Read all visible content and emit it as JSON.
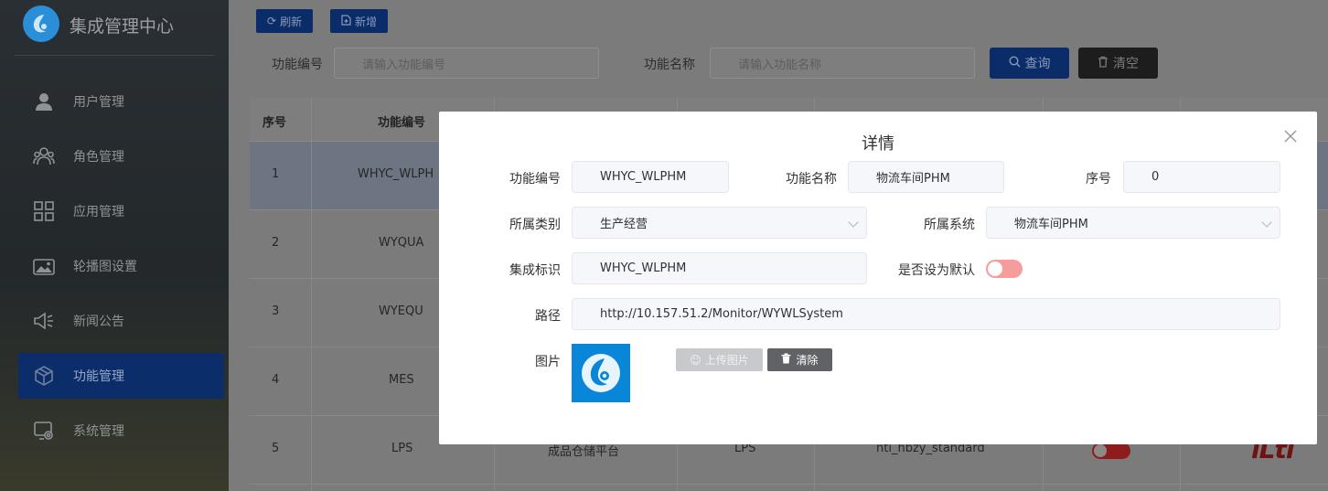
{
  "brand": {
    "title": "集成管理中心"
  },
  "sidebar": {
    "items": [
      {
        "label": "用户管理",
        "icon": "user-icon"
      },
      {
        "label": "角色管理",
        "icon": "role-icon"
      },
      {
        "label": "应用管理",
        "icon": "apps-grid-icon"
      },
      {
        "label": "轮播图设置",
        "icon": "image-icon"
      },
      {
        "label": "新闻公告",
        "icon": "megaphone-icon"
      },
      {
        "label": "功能管理",
        "icon": "box-icon",
        "active": true
      },
      {
        "label": "系统管理",
        "icon": "settings-screen-icon"
      }
    ]
  },
  "toolbar": {
    "refresh_label": "刷新",
    "add_label": "新增"
  },
  "filters": {
    "code_label": "功能编号",
    "code_placeholder": "请输入功能编号",
    "name_label": "功能名称",
    "name_placeholder": "请输入功能名称",
    "query_label": "查询",
    "clear_label": "清空"
  },
  "table": {
    "headers": {
      "index": "序号",
      "code": "功能编号"
    },
    "rows": [
      {
        "index": "1",
        "code": "WHYC_WLPH"
      },
      {
        "index": "2",
        "code": "WYQUA"
      },
      {
        "index": "3",
        "code": "WYEQU"
      },
      {
        "index": "4",
        "code": "MES"
      },
      {
        "index": "5",
        "code": "LPS",
        "name": "成品仓储平台",
        "system": "LPS",
        "marker": "nti_hbzy_standard",
        "logo_text": "iLti"
      }
    ]
  },
  "dialog": {
    "title": "详情",
    "fields": {
      "code_label": "功能编号",
      "code_value": "WHYC_WLPHM",
      "name_label": "功能名称",
      "name_value": "物流车间PHM",
      "order_label": "序号",
      "order_value": "0",
      "category_label": "所属类别",
      "category_value": "生产经营",
      "system_label": "所属系统",
      "system_value": "物流车间PHM",
      "marker_label": "集成标识",
      "marker_value": "WHYC_WLPHM",
      "default_label": "是否设为默认",
      "default_value": false,
      "path_label": "路径",
      "path_value": "http://10.157.51.2/Monitor/WYWLSystem",
      "image_label": "图片"
    },
    "upload_label": "上传图片",
    "remove_label": "清除"
  },
  "colors": {
    "accent": "#0a2c68",
    "toggle_off": "#f79c9c",
    "thumbnail_bg": "#0a86d8"
  }
}
